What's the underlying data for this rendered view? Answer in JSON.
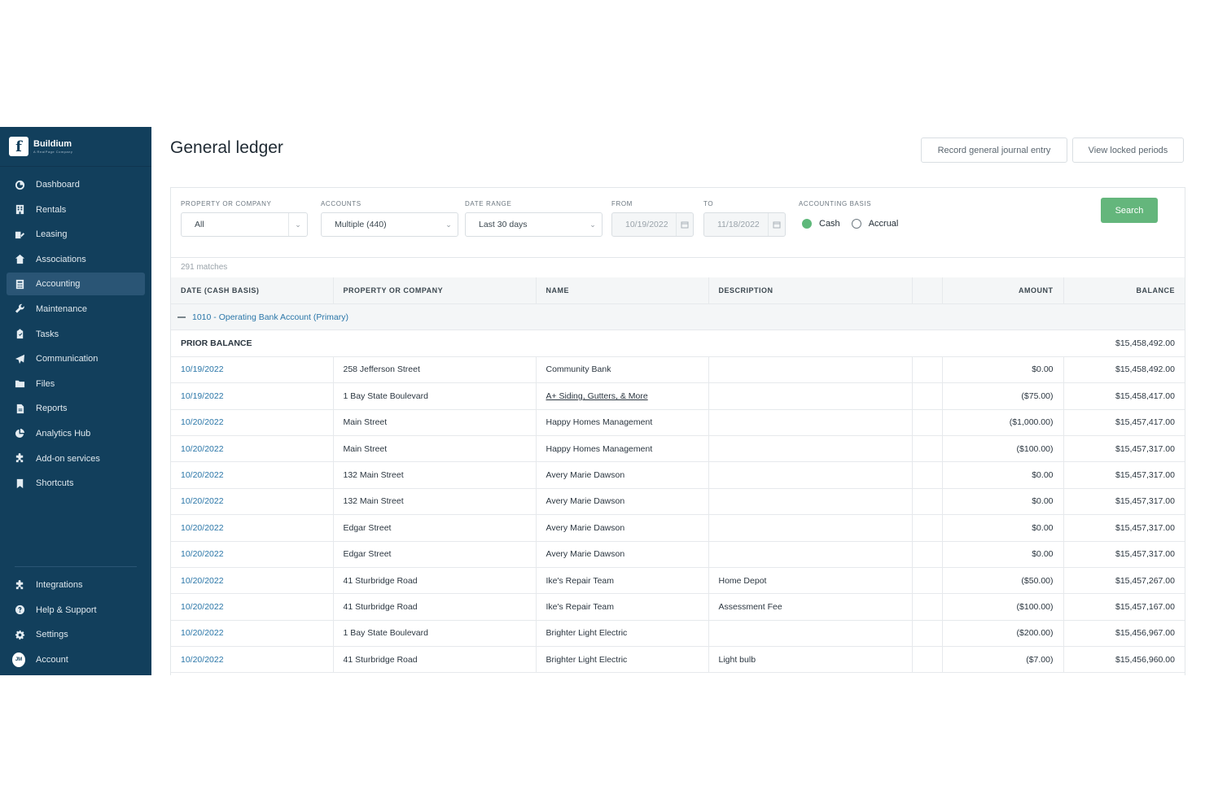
{
  "brand": {
    "name": "Buildium",
    "sub": "A RealPage Company"
  },
  "sidebar": {
    "items": [
      {
        "label": "Dashboard",
        "icon": "dashboard-icon"
      },
      {
        "label": "Rentals",
        "icon": "building-icon"
      },
      {
        "label": "Leasing",
        "icon": "leasing-icon"
      },
      {
        "label": "Associations",
        "icon": "house-icon"
      },
      {
        "label": "Accounting",
        "icon": "calculator-icon",
        "active": true
      },
      {
        "label": "Maintenance",
        "icon": "wrench-icon"
      },
      {
        "label": "Tasks",
        "icon": "clipboard-icon"
      },
      {
        "label": "Communication",
        "icon": "paper-plane-icon"
      },
      {
        "label": "Files",
        "icon": "folder-icon"
      },
      {
        "label": "Reports",
        "icon": "report-icon"
      },
      {
        "label": "Analytics Hub",
        "icon": "pie-chart-icon"
      },
      {
        "label": "Add-on services",
        "icon": "puzzle-icon"
      },
      {
        "label": "Shortcuts",
        "icon": "bookmark-icon"
      }
    ],
    "bottom": [
      {
        "label": "Integrations",
        "icon": "puzzle-icon"
      },
      {
        "label": "Help & Support",
        "icon": "help-icon"
      },
      {
        "label": "Settings",
        "icon": "gear-icon"
      },
      {
        "label": "Account",
        "icon": "avatar",
        "initials": "JM"
      }
    ]
  },
  "page": {
    "title": "General ledger",
    "record_journal_label": "Record general journal entry",
    "view_locked_label": "View locked periods"
  },
  "filters": {
    "property_label": "PROPERTY OR COMPANY",
    "property_value": "All",
    "accounts_label": "ACCOUNTS",
    "accounts_value": "Multiple (440)",
    "date_range_label": "DATE RANGE",
    "date_range_value": "Last 30 days",
    "from_label": "FROM",
    "from_value": "10/19/2022",
    "to_label": "TO",
    "to_value": "11/18/2022",
    "basis_label": "ACCOUNTING BASIS",
    "cash_label": "Cash",
    "accrual_label": "Accrual",
    "selected_basis": "Cash",
    "search_label": "Search"
  },
  "table": {
    "matches": "291 matches",
    "columns": [
      "DATE (CASH BASIS)",
      "PROPERTY OR COMPANY",
      "NAME",
      "DESCRIPTION",
      "",
      "AMOUNT",
      "BALANCE"
    ],
    "group_label": "1010 - Operating Bank Account (Primary)",
    "prior_label": "PRIOR BALANCE",
    "prior_value": "$15,458,492.00",
    "rows": [
      {
        "date": "10/19/2022",
        "property": "258 Jefferson Street",
        "name": "Community Bank",
        "description": "",
        "amount": "$0.00",
        "balance": "$15,458,492.00"
      },
      {
        "date": "10/19/2022",
        "property": "1 Bay State Boulevard",
        "name": "A+ Siding, Gutters, & More",
        "description": "",
        "amount": "($75.00)",
        "balance": "$15,458,417.00",
        "name_underline": true
      },
      {
        "date": "10/20/2022",
        "property": "Main Street",
        "name": "Happy Homes Management",
        "description": "",
        "amount": "($1,000.00)",
        "balance": "$15,457,417.00"
      },
      {
        "date": "10/20/2022",
        "property": "Main Street",
        "name": "Happy Homes Management",
        "description": "",
        "amount": "($100.00)",
        "balance": "$15,457,317.00"
      },
      {
        "date": "10/20/2022",
        "property": "132 Main Street",
        "name": "Avery Marie Dawson",
        "description": "",
        "amount": "$0.00",
        "balance": "$15,457,317.00"
      },
      {
        "date": "10/20/2022",
        "property": "132 Main Street",
        "name": "Avery Marie Dawson",
        "description": "",
        "amount": "$0.00",
        "balance": "$15,457,317.00"
      },
      {
        "date": "10/20/2022",
        "property": "Edgar Street",
        "name": "Avery Marie Dawson",
        "description": "",
        "amount": "$0.00",
        "balance": "$15,457,317.00"
      },
      {
        "date": "10/20/2022",
        "property": "Edgar Street",
        "name": "Avery Marie Dawson",
        "description": "",
        "amount": "$0.00",
        "balance": "$15,457,317.00"
      },
      {
        "date": "10/20/2022",
        "property": "41 Sturbridge Road",
        "name": "Ike's Repair Team",
        "description": "Home Depot",
        "amount": "($50.00)",
        "balance": "$15,457,267.00"
      },
      {
        "date": "10/20/2022",
        "property": "41 Sturbridge Road",
        "name": "Ike's Repair Team",
        "description": "Assessment Fee",
        "amount": "($100.00)",
        "balance": "$15,457,167.00"
      },
      {
        "date": "10/20/2022",
        "property": "1 Bay State Boulevard",
        "name": "Brighter Light Electric",
        "description": "",
        "amount": "($200.00)",
        "balance": "$15,456,967.00"
      },
      {
        "date": "10/20/2022",
        "property": "41 Sturbridge Road",
        "name": "Brighter Light Electric",
        "description": "Light bulb",
        "amount": "($7.00)",
        "balance": "$15,456,960.00"
      }
    ]
  },
  "colors": {
    "sidebar": "#123f5c",
    "active": "#2a5575",
    "accent": "#2a76a8",
    "search": "#64b67c"
  }
}
